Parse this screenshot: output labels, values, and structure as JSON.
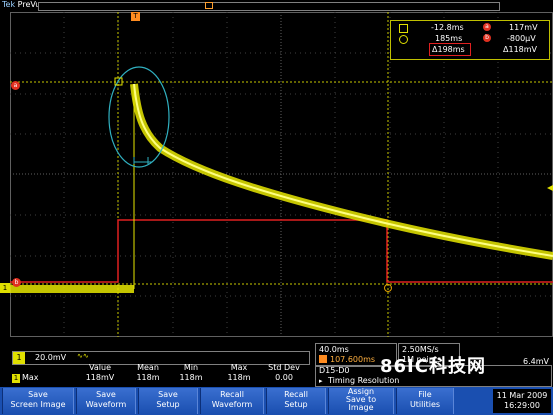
{
  "header": {
    "brand_tek": "Tek",
    "brand_mode": "PreVu",
    "trigger_marker": "T"
  },
  "readout": {
    "cursor1_time": "-12.8ms",
    "cursor2_time": "185ms",
    "delta_time": "Δ198ms",
    "cursor_a_value": "117mV",
    "cursor_b_value": "-800μV",
    "delta_value": "Δ118mV",
    "badge_a": "a",
    "badge_b": "b"
  },
  "left_markers": {
    "a": "a",
    "b": "b",
    "ch1": "1"
  },
  "scale": {
    "channel": "1",
    "volts_div": "20.0mV",
    "coupling": "∿∿"
  },
  "measurements": {
    "headers": [
      "Value",
      "Mean",
      "Min",
      "Max",
      "Std Dev"
    ],
    "channel": "1",
    "name": "Max",
    "values": [
      "118mV",
      "118m",
      "118m",
      "118m",
      "0.00"
    ]
  },
  "timebase": {
    "time_div": "40.0ms",
    "trigger_delay": "107.600ms",
    "sample_rate": "2.50MS/s",
    "record_length": "1M points"
  },
  "digital": {
    "channels": "D15-D0",
    "timing": "Timing Resolution",
    "right_value": "6.4mV"
  },
  "buttons": [
    {
      "label": "Save\nScreen Image"
    },
    {
      "label": "Save\nWaveform"
    },
    {
      "label": "Save\nSetup"
    },
    {
      "label": "Recall\nWaveform"
    },
    {
      "label": "Recall\nSetup"
    },
    {
      "label": "Assign\nSave to\nImage"
    },
    {
      "label": "File\nUtilities"
    }
  ],
  "date": {
    "date": "11 Mar 2009",
    "time": "16:29:00"
  },
  "watermark": "86IC科技网",
  "colors": {
    "trace": "#e8e800",
    "grid": "#505050",
    "cursor": "#d0d000",
    "delta_box": "#e02020",
    "ellipse": "#30b0c0",
    "button_bar": "#1a4fb0"
  }
}
